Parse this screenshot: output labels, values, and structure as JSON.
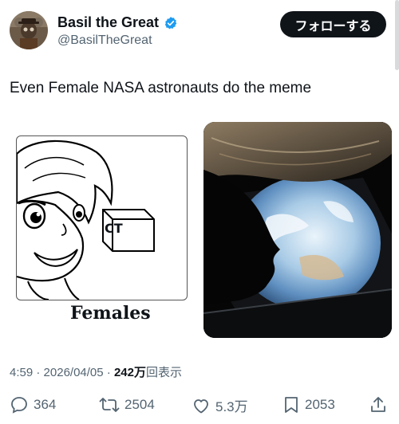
{
  "author": {
    "name": "Basil the Great",
    "handle": "@BasilTheGreat",
    "verified_color": "#1d9bf0",
    "verified_icon": "verified-badge-icon",
    "follow_label": "フォローする"
  },
  "tweet": {
    "text": "Even Female NASA astronauts do the meme",
    "meme_caption": "Females",
    "meme_box_text": "CT"
  },
  "meta": {
    "time": "4:59",
    "date": "2026/04/05",
    "views": "242万",
    "views_suffix": "回表示",
    "separator": "·"
  },
  "actions": {
    "replies": "364",
    "reposts": "2504",
    "likes": "5.3万",
    "bookmarks": "2053"
  },
  "colors": {
    "text_primary": "#0f1419",
    "text_secondary": "#536471",
    "accent": "#1d9bf0"
  }
}
